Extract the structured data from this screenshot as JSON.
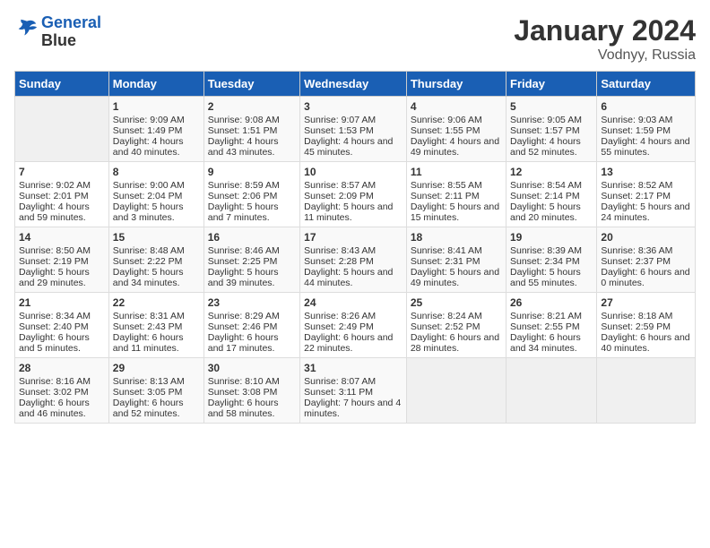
{
  "header": {
    "logo_line1": "General",
    "logo_line2": "Blue",
    "month": "January 2024",
    "location": "Vodnyy, Russia"
  },
  "weekdays": [
    "Sunday",
    "Monday",
    "Tuesday",
    "Wednesday",
    "Thursday",
    "Friday",
    "Saturday"
  ],
  "weeks": [
    [
      {
        "day": "",
        "empty": true
      },
      {
        "day": "1",
        "sunrise": "Sunrise: 9:09 AM",
        "sunset": "Sunset: 1:49 PM",
        "daylight": "Daylight: 4 hours and 40 minutes."
      },
      {
        "day": "2",
        "sunrise": "Sunrise: 9:08 AM",
        "sunset": "Sunset: 1:51 PM",
        "daylight": "Daylight: 4 hours and 43 minutes."
      },
      {
        "day": "3",
        "sunrise": "Sunrise: 9:07 AM",
        "sunset": "Sunset: 1:53 PM",
        "daylight": "Daylight: 4 hours and 45 minutes."
      },
      {
        "day": "4",
        "sunrise": "Sunrise: 9:06 AM",
        "sunset": "Sunset: 1:55 PM",
        "daylight": "Daylight: 4 hours and 49 minutes."
      },
      {
        "day": "5",
        "sunrise": "Sunrise: 9:05 AM",
        "sunset": "Sunset: 1:57 PM",
        "daylight": "Daylight: 4 hours and 52 minutes."
      },
      {
        "day": "6",
        "sunrise": "Sunrise: 9:03 AM",
        "sunset": "Sunset: 1:59 PM",
        "daylight": "Daylight: 4 hours and 55 minutes."
      }
    ],
    [
      {
        "day": "7",
        "sunrise": "Sunrise: 9:02 AM",
        "sunset": "Sunset: 2:01 PM",
        "daylight": "Daylight: 4 hours and 59 minutes."
      },
      {
        "day": "8",
        "sunrise": "Sunrise: 9:00 AM",
        "sunset": "Sunset: 2:04 PM",
        "daylight": "Daylight: 5 hours and 3 minutes."
      },
      {
        "day": "9",
        "sunrise": "Sunrise: 8:59 AM",
        "sunset": "Sunset: 2:06 PM",
        "daylight": "Daylight: 5 hours and 7 minutes."
      },
      {
        "day": "10",
        "sunrise": "Sunrise: 8:57 AM",
        "sunset": "Sunset: 2:09 PM",
        "daylight": "Daylight: 5 hours and 11 minutes."
      },
      {
        "day": "11",
        "sunrise": "Sunrise: 8:55 AM",
        "sunset": "Sunset: 2:11 PM",
        "daylight": "Daylight: 5 hours and 15 minutes."
      },
      {
        "day": "12",
        "sunrise": "Sunrise: 8:54 AM",
        "sunset": "Sunset: 2:14 PM",
        "daylight": "Daylight: 5 hours and 20 minutes."
      },
      {
        "day": "13",
        "sunrise": "Sunrise: 8:52 AM",
        "sunset": "Sunset: 2:17 PM",
        "daylight": "Daylight: 5 hours and 24 minutes."
      }
    ],
    [
      {
        "day": "14",
        "sunrise": "Sunrise: 8:50 AM",
        "sunset": "Sunset: 2:19 PM",
        "daylight": "Daylight: 5 hours and 29 minutes."
      },
      {
        "day": "15",
        "sunrise": "Sunrise: 8:48 AM",
        "sunset": "Sunset: 2:22 PM",
        "daylight": "Daylight: 5 hours and 34 minutes."
      },
      {
        "day": "16",
        "sunrise": "Sunrise: 8:46 AM",
        "sunset": "Sunset: 2:25 PM",
        "daylight": "Daylight: 5 hours and 39 minutes."
      },
      {
        "day": "17",
        "sunrise": "Sunrise: 8:43 AM",
        "sunset": "Sunset: 2:28 PM",
        "daylight": "Daylight: 5 hours and 44 minutes."
      },
      {
        "day": "18",
        "sunrise": "Sunrise: 8:41 AM",
        "sunset": "Sunset: 2:31 PM",
        "daylight": "Daylight: 5 hours and 49 minutes."
      },
      {
        "day": "19",
        "sunrise": "Sunrise: 8:39 AM",
        "sunset": "Sunset: 2:34 PM",
        "daylight": "Daylight: 5 hours and 55 minutes."
      },
      {
        "day": "20",
        "sunrise": "Sunrise: 8:36 AM",
        "sunset": "Sunset: 2:37 PM",
        "daylight": "Daylight: 6 hours and 0 minutes."
      }
    ],
    [
      {
        "day": "21",
        "sunrise": "Sunrise: 8:34 AM",
        "sunset": "Sunset: 2:40 PM",
        "daylight": "Daylight: 6 hours and 5 minutes."
      },
      {
        "day": "22",
        "sunrise": "Sunrise: 8:31 AM",
        "sunset": "Sunset: 2:43 PM",
        "daylight": "Daylight: 6 hours and 11 minutes."
      },
      {
        "day": "23",
        "sunrise": "Sunrise: 8:29 AM",
        "sunset": "Sunset: 2:46 PM",
        "daylight": "Daylight: 6 hours and 17 minutes."
      },
      {
        "day": "24",
        "sunrise": "Sunrise: 8:26 AM",
        "sunset": "Sunset: 2:49 PM",
        "daylight": "Daylight: 6 hours and 22 minutes."
      },
      {
        "day": "25",
        "sunrise": "Sunrise: 8:24 AM",
        "sunset": "Sunset: 2:52 PM",
        "daylight": "Daylight: 6 hours and 28 minutes."
      },
      {
        "day": "26",
        "sunrise": "Sunrise: 8:21 AM",
        "sunset": "Sunset: 2:55 PM",
        "daylight": "Daylight: 6 hours and 34 minutes."
      },
      {
        "day": "27",
        "sunrise": "Sunrise: 8:18 AM",
        "sunset": "Sunset: 2:59 PM",
        "daylight": "Daylight: 6 hours and 40 minutes."
      }
    ],
    [
      {
        "day": "28",
        "sunrise": "Sunrise: 8:16 AM",
        "sunset": "Sunset: 3:02 PM",
        "daylight": "Daylight: 6 hours and 46 minutes."
      },
      {
        "day": "29",
        "sunrise": "Sunrise: 8:13 AM",
        "sunset": "Sunset: 3:05 PM",
        "daylight": "Daylight: 6 hours and 52 minutes."
      },
      {
        "day": "30",
        "sunrise": "Sunrise: 8:10 AM",
        "sunset": "Sunset: 3:08 PM",
        "daylight": "Daylight: 6 hours and 58 minutes."
      },
      {
        "day": "31",
        "sunrise": "Sunrise: 8:07 AM",
        "sunset": "Sunset: 3:11 PM",
        "daylight": "Daylight: 7 hours and 4 minutes."
      },
      {
        "day": "",
        "empty": true
      },
      {
        "day": "",
        "empty": true
      },
      {
        "day": "",
        "empty": true
      }
    ]
  ]
}
